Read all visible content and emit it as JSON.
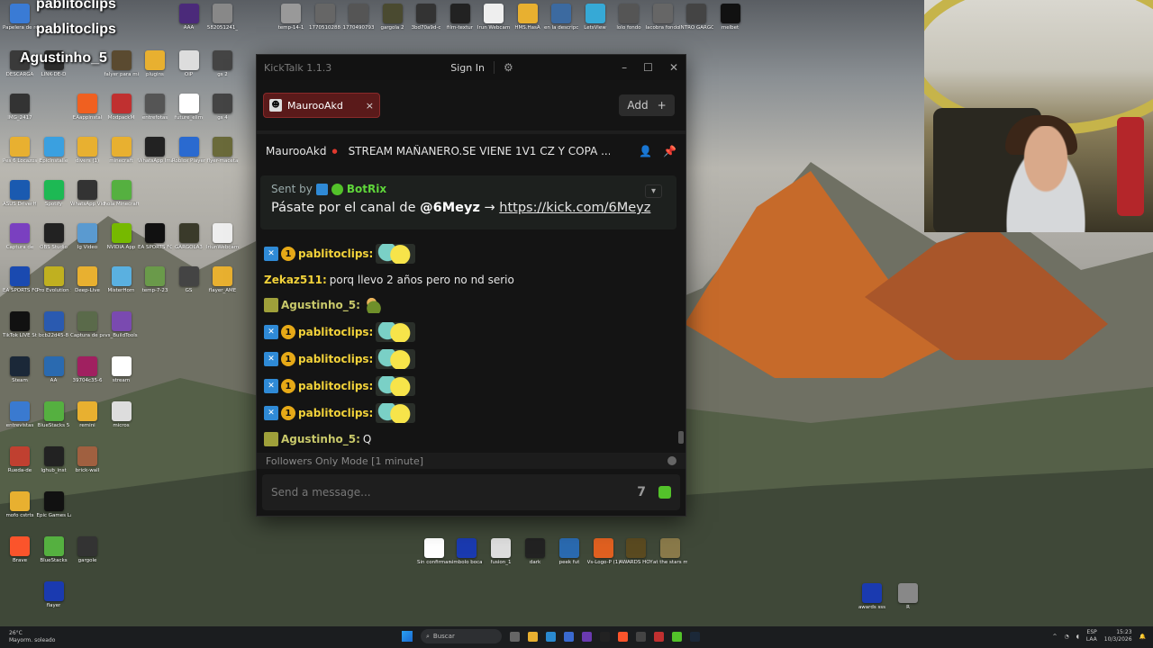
{
  "desktop": {
    "overlay_names": [
      "pablitoclips",
      "pablitoclips",
      "Agustinho_5"
    ],
    "icons": [
      {
        "label": "Papelera de reciclaje",
        "color": "#3a7bd5"
      },
      {
        "label": "AAA",
        "color": "#4b2a7a"
      },
      {
        "label": "582051241_",
        "color": "#888"
      },
      {
        "label": "temp-14-1",
        "color": "#999"
      },
      {
        "label": "1770510288",
        "color": "#666"
      },
      {
        "label": "1770490793",
        "color": "#555"
      },
      {
        "label": "gargola 2",
        "color": "#4a4a30"
      },
      {
        "label": "3bd70a9d-c",
        "color": "#333"
      },
      {
        "label": "film-textur",
        "color": "#222"
      },
      {
        "label": "Irun Webcam",
        "color": "#eee"
      },
      {
        "label": "HMS.HasA",
        "color": "#e8b030"
      },
      {
        "label": "en la descripci",
        "color": "#3c6aa0"
      },
      {
        "label": "LetsView",
        "color": "#36a9d6"
      },
      {
        "label": "lolo fondo",
        "color": "#555"
      },
      {
        "label": "lacobra fondo",
        "color": "#666"
      },
      {
        "label": "INTRO GARGO",
        "color": "#444"
      },
      {
        "label": "melbet",
        "color": "#111"
      },
      {
        "label": "DESCARGA",
        "color": "#3a3a3a"
      },
      {
        "label": "LINK-DE-D",
        "color": "#2b2b2b"
      },
      {
        "label": "falyer para miguel",
        "color": "#5a4a30"
      },
      {
        "label": "plugins",
        "color": "#e8b030"
      },
      {
        "label": "OIP",
        "color": "#ddd"
      },
      {
        "label": "gs 2",
        "color": "#444"
      },
      {
        "label": "temp-14-1",
        "color": "#777"
      },
      {
        "label": "IMG_2417",
        "color": "#333"
      },
      {
        "label": "EAappinstal",
        "color": "#f06020"
      },
      {
        "label": "ModpackM",
        "color": "#c03030"
      },
      {
        "label": "entrefotas",
        "color": "#555"
      },
      {
        "label": "future_elim",
        "color": "#fff"
      },
      {
        "label": "gs 4",
        "color": "#444"
      },
      {
        "label": "Pes 6 Locazos",
        "color": "#e8b030"
      },
      {
        "label": "EpicInstalle",
        "color": "#3aa0e0"
      },
      {
        "label": "divers (1)",
        "color": "#e8b030"
      },
      {
        "label": "minecraft",
        "color": "#e8b030"
      },
      {
        "label": "WhatsApp Image 2025",
        "color": "#222"
      },
      {
        "label": "Roblox Player",
        "color": "#2a6ad0"
      },
      {
        "label": "flyer-maceta",
        "color": "#6a6a3a"
      },
      {
        "label": "ASUS DriverHub",
        "color": "#1a5ab0"
      },
      {
        "label": "Spotify",
        "color": "#1db954"
      },
      {
        "label": "WhatsApp Video 2025",
        "color": "#333"
      },
      {
        "label": "hola Minecraft",
        "color": "#55b040"
      },
      {
        "label": "Captura de",
        "color": "#7a40c0"
      },
      {
        "label": "OBS Studio",
        "color": "#222"
      },
      {
        "label": "lg Video",
        "color": "#5a9ad0"
      },
      {
        "label": "NVIDIA App",
        "color": "#76b900"
      },
      {
        "label": "EA SPORTS FC 26",
        "color": "#111"
      },
      {
        "label": "GARGOLA3",
        "color": "#3a3a2a"
      },
      {
        "label": "IriunWebcam",
        "color": "#eee"
      },
      {
        "label": "EA SPORTS FC 26",
        "color": "#1a4ab0"
      },
      {
        "label": "Pro Evolution Soccer 6",
        "color": "#c0b020"
      },
      {
        "label": "Deep-Live",
        "color": "#e8b030"
      },
      {
        "label": "MisterHorn",
        "color": "#5ab0e0"
      },
      {
        "label": "temp-7-23",
        "color": "#6a9a4a"
      },
      {
        "label": "GS",
        "color": "#444"
      },
      {
        "label": "flayer_AME",
        "color": "#e8b030"
      },
      {
        "label": "TikTok LIVE Studio",
        "color": "#111"
      },
      {
        "label": "bcb22d45-8",
        "color": "#2a5ab0"
      },
      {
        "label": "Captura de pantalla",
        "color": "#5a6a4a"
      },
      {
        "label": "vs_BuildTools",
        "color": "#7a4ab0"
      },
      {
        "label": "Steam",
        "color": "#1b2838"
      },
      {
        "label": "AA",
        "color": "#2a6ab0"
      },
      {
        "label": "39704c35-6",
        "color": "#a02060"
      },
      {
        "label": "stream",
        "color": "#fff"
      },
      {
        "label": "entrevistas",
        "color": "#3a7ad0"
      },
      {
        "label": "BlueStacks 5",
        "color": "#55b040"
      },
      {
        "label": "remini",
        "color": "#e8b030"
      },
      {
        "label": "micros",
        "color": "#ddd"
      },
      {
        "label": "Rueda-de",
        "color": "#c04030"
      },
      {
        "label": "Ighub_inst",
        "color": "#222"
      },
      {
        "label": "brick-wall",
        "color": "#a06040"
      },
      {
        "label": "mofo cstrts",
        "color": "#e8b030"
      },
      {
        "label": "Epic Games Launcher",
        "color": "#111"
      },
      {
        "label": "Brave",
        "color": "#fb542b"
      },
      {
        "label": "BlueStacks",
        "color": "#55b040"
      },
      {
        "label": "gargole",
        "color": "#333"
      },
      {
        "label": "flayer",
        "color": "#1a3ab0"
      },
      {
        "label": "Sin confirmar 462937.crd",
        "color": "#fff"
      },
      {
        "label": "simbolo boca pasta",
        "color": "#1a3ab0"
      },
      {
        "label": "fusion_1",
        "color": "#ddd"
      },
      {
        "label": "dark",
        "color": "#222"
      },
      {
        "label": "peek fut",
        "color": "#2a6ab0"
      },
      {
        "label": "Vs-Logo-P (1)",
        "color": "#e06020"
      },
      {
        "label": "AWARDS HOY",
        "color": "#5a4a20"
      },
      {
        "label": "at the stars mate akd",
        "color": "#8a7a4a"
      },
      {
        "label": "awards sss",
        "color": "#1a3ab0"
      },
      {
        "label": "R",
        "color": "#888"
      },
      {
        "label": "papel-textu",
        "color": "#eee"
      }
    ]
  },
  "window": {
    "app_title": "KickTalk 1.1.3",
    "sign_in": "Sign In",
    "settings_icon": "gear-icon",
    "minimize_icon": "minimize-icon",
    "maximize_icon": "maximize-icon",
    "close_icon": "close-icon",
    "tab": {
      "label": "MaurooAkd",
      "close": "×"
    },
    "add_button": {
      "label": "Add",
      "icon": "+"
    },
    "channel": {
      "name": "MaurooAkd",
      "title": "STREAM MAÑANERO.SE VIENE 1V1 CZ Y COPA ..."
    },
    "pinned": {
      "sent_by": "Sent by",
      "bot_name": "BotRix",
      "message_prefix": "Pásate por el canal de",
      "mention": "@6Meyz",
      "arrow": "→",
      "link": "https://kick.com/6Meyz"
    },
    "messages": [
      {
        "user": "pablitoclips:",
        "color": "#f2d23a",
        "badges": [
          "bot",
          "sub"
        ],
        "text": "",
        "emote": "yellow-blob-emote"
      },
      {
        "user": "Zekaz511:",
        "color": "#f2d23a",
        "badges": [],
        "text": "porq llevo 2 años pero no nd serio",
        "emote": ""
      },
      {
        "user": "Agustinho_5:",
        "color": "#c9c96a",
        "badges": [
          "avatar"
        ],
        "text": "",
        "emote": "frog-emote"
      },
      {
        "user": "pablitoclips:",
        "color": "#f2d23a",
        "badges": [
          "bot",
          "sub"
        ],
        "text": "",
        "emote": "yellow-blob-emote"
      },
      {
        "user": "pablitoclips:",
        "color": "#f2d23a",
        "badges": [
          "bot",
          "sub"
        ],
        "text": "",
        "emote": "yellow-blob-emote"
      },
      {
        "user": "pablitoclips:",
        "color": "#f2d23a",
        "badges": [
          "bot",
          "sub"
        ],
        "text": "",
        "emote": "yellow-blob-emote"
      },
      {
        "user": "pablitoclips:",
        "color": "#f2d23a",
        "badges": [
          "bot",
          "sub"
        ],
        "text": "",
        "emote": "yellow-blob-emote"
      },
      {
        "user": "Agustinho_5:",
        "color": "#c9c96a",
        "badges": [
          "avatar"
        ],
        "text": "Q",
        "emote": ""
      }
    ],
    "followers_mode": "Followers Only Mode [1 minute]",
    "input_placeholder": "Send a message...",
    "input_value": "",
    "seventv_label": "7tv",
    "sub_badge_number": "1"
  },
  "taskbar": {
    "weather_temp": "26°C",
    "weather_desc": "Mayorm. soleado",
    "search_label": "Buscar",
    "lang": "ESP",
    "lang_sub": "LAA",
    "time": "15:23",
    "date": "10/3/2026"
  },
  "colors": {
    "accent_red": "#5a1a1a",
    "kick_green": "#53c22a",
    "bot_blue": "#2f8ad6",
    "sub_gold": "#e6a917"
  }
}
